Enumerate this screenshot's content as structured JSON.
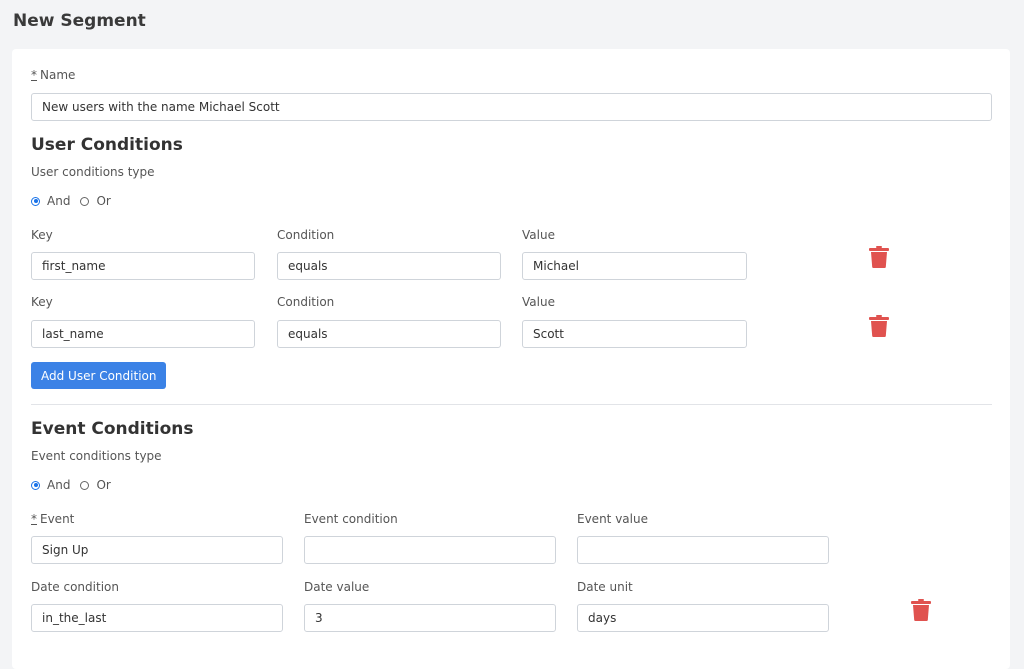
{
  "header": {
    "title": "New Segment"
  },
  "name_field": {
    "required_mark": "*",
    "label": "Name",
    "value": "New users with the name Michael Scott"
  },
  "user_conditions": {
    "title": "User Conditions",
    "type_label": "User conditions type",
    "options": [
      {
        "label": "And",
        "checked": true
      },
      {
        "label": "Or",
        "checked": false
      }
    ],
    "rows": [
      {
        "key_label": "Key",
        "condition_label": "Condition",
        "value_label": "Value",
        "key": "first_name",
        "condition": "equals",
        "value": "Michael"
      },
      {
        "key_label": "Key",
        "condition_label": "Condition",
        "value_label": "Value",
        "key": "last_name",
        "condition": "equals",
        "value": "Scott"
      }
    ],
    "add_button": "Add User Condition"
  },
  "event_conditions": {
    "title": "Event Conditions",
    "type_label": "Event conditions type",
    "options": [
      {
        "label": "And",
        "checked": true
      },
      {
        "label": "Or",
        "checked": false
      }
    ],
    "event": {
      "required_mark": "*",
      "event_label": "Event",
      "event_value": "Sign Up",
      "event_condition_label": "Event condition",
      "event_condition_value": "",
      "event_value_label": "Event value",
      "event_value_value": "",
      "date_condition_label": "Date condition",
      "date_condition_value": "in_the_last",
      "date_value_label": "Date value",
      "date_value_value": "3",
      "date_unit_label": "Date unit",
      "date_unit_value": "days"
    }
  },
  "colors": {
    "primary": "#3b82e6",
    "danger": "#e0524f",
    "radio": "#1a73e8"
  },
  "icons": {
    "delete": "trash-icon"
  }
}
